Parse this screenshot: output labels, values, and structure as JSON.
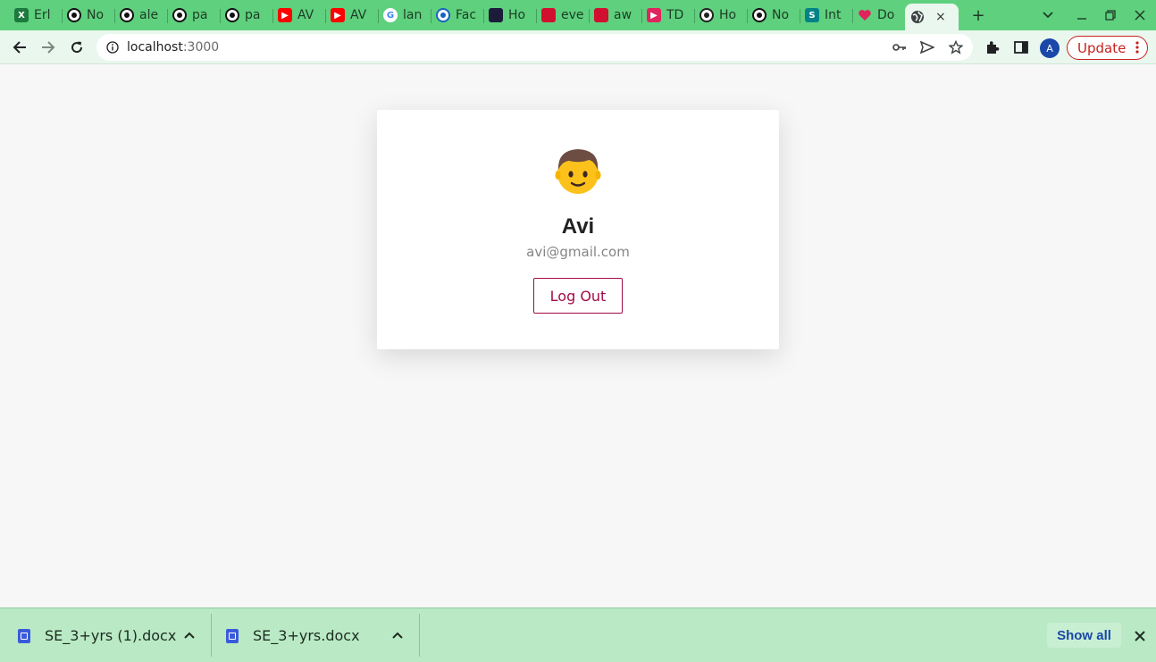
{
  "browser": {
    "tabs": [
      {
        "title": "Erl",
        "icon": "excel-icon",
        "color": "#1d7a3e"
      },
      {
        "title": "No",
        "icon": "github-icon",
        "color": "#111111"
      },
      {
        "title": "ale",
        "icon": "github-icon",
        "color": "#111111"
      },
      {
        "title": "pa",
        "icon": "github-icon",
        "color": "#111111"
      },
      {
        "title": "pa",
        "icon": "github-icon",
        "color": "#111111"
      },
      {
        "title": "AV",
        "icon": "youtube-icon",
        "color": "#ff0000"
      },
      {
        "title": "AV",
        "icon": "youtube-icon",
        "color": "#ff0000"
      },
      {
        "title": "lan",
        "icon": "google-icon",
        "color": "#4285f4"
      },
      {
        "title": "Fac",
        "icon": "pin-icon",
        "color": "#1565c0"
      },
      {
        "title": "Ho",
        "icon": "nuxt-icon",
        "color": "#1b1b3a"
      },
      {
        "title": "eve",
        "icon": "opera-icon",
        "color": "#d10f2e"
      },
      {
        "title": "aw",
        "icon": "opera-icon",
        "color": "#d10f2e"
      },
      {
        "title": "TD",
        "icon": "play-icon",
        "color": "#e0245e"
      },
      {
        "title": "Ho",
        "icon": "x-circle-icon",
        "color": "#222222"
      },
      {
        "title": "No",
        "icon": "github-icon",
        "color": "#111111"
      },
      {
        "title": "Int",
        "icon": "sharepoint-icon",
        "color": "#038387"
      },
      {
        "title": "Do",
        "icon": "heart-icon",
        "color": "#e0245e"
      }
    ],
    "active_tab": {
      "icon": "globe-icon",
      "close_glyph": "×"
    },
    "new_tab_glyph": "+",
    "url_host": "localhost",
    "url_port": ":3000",
    "profile_initial": "A",
    "update_label": "Update"
  },
  "profile_card": {
    "emoji_icon": "boy-emoji-icon",
    "name": "Avi",
    "email": "avi@gmail.com",
    "logout_label": "Log Out"
  },
  "downloads": {
    "items": [
      {
        "name": "SE_3+yrs (1).docx"
      },
      {
        "name": "SE_3+yrs.docx"
      }
    ],
    "show_all_label": "Show all"
  },
  "colors": {
    "tabstrip": "#5fd07e",
    "toolbar": "#eaf7ee",
    "accent_logout": "#a30b47",
    "update_red": "#c5221f",
    "shelf": "#b9eac5"
  }
}
